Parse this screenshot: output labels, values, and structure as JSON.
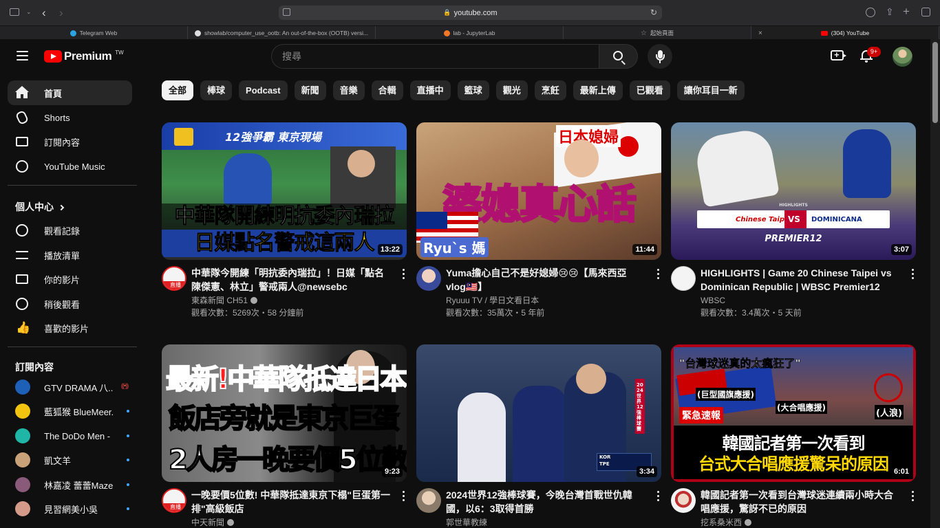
{
  "browser": {
    "url": "youtube.com",
    "tabs": [
      {
        "label": "Telegram Web",
        "color": "#2aa3e0"
      },
      {
        "label": "showlab/computer_use_ootb: An out-of-the-box (OOTB) versi...",
        "color": "#dddddd"
      },
      {
        "label": "lab - JupyterLab",
        "color": "#f37726"
      },
      {
        "label": "起始頁面",
        "color": "#999999"
      },
      {
        "label": "(304) YouTube",
        "color": "#ff0000"
      }
    ]
  },
  "masthead": {
    "logo_text": "Premium",
    "region": "TW",
    "search_placeholder": "搜尋",
    "notification_count": "9+"
  },
  "sidebar": {
    "main": [
      {
        "label": "首頁",
        "icon": "home-icon"
      },
      {
        "label": "Shorts",
        "icon": "shorts-icon"
      },
      {
        "label": "訂閱內容",
        "icon": "subscriptions-icon"
      },
      {
        "label": "YouTube Music",
        "icon": "youtube-music-icon"
      }
    ],
    "you_header": "個人中心",
    "you": [
      {
        "label": "觀看記錄",
        "icon": "history-icon"
      },
      {
        "label": "播放清單",
        "icon": "playlists-icon"
      },
      {
        "label": "你的影片",
        "icon": "your-videos-icon"
      },
      {
        "label": "稍後觀看",
        "icon": "watch-later-icon"
      },
      {
        "label": "喜歡的影片",
        "icon": "liked-videos-icon"
      }
    ],
    "subs_header": "訂閱內容",
    "subscriptions": [
      {
        "label": "GTV DRAMA 八...",
        "live": true,
        "color": "#1e5fb8"
      },
      {
        "label": "藍狐猴 BlueMeer...",
        "live": false,
        "color": "#f2c40f"
      },
      {
        "label": "The DoDo Men - ...",
        "live": false,
        "color": "#1fb6a8"
      },
      {
        "label": "凱文羊",
        "live": false,
        "color": "#c9a27a"
      },
      {
        "label": "林嘉凌 蕾蕾Maze",
        "live": false,
        "color": "#8a5a7a"
      },
      {
        "label": "見習網美小吳",
        "live": false,
        "color": "#d49a8a"
      }
    ]
  },
  "chips": [
    "全部",
    "棒球",
    "Podcast",
    "新聞",
    "音樂",
    "合輯",
    "直播中",
    "籃球",
    "觀光",
    "烹飪",
    "最新上傳",
    "已觀看",
    "讓你耳目一新"
  ],
  "videos": [
    {
      "title": "中華隊今開練「明抗委內瑞拉」！日媒「點名 陳傑憲、林立」警戒兩人@newsebc",
      "channel": "東森新聞 CH51",
      "verified": true,
      "stats": "觀看次數：5269次・58 分鐘前",
      "duration": "13:22",
      "thumb_lines": [
        "中華隊開練明抗委內瑞拉",
        "日媒點名警戒這兩人"
      ],
      "thumb_top": "12強爭霸 東京現場",
      "avatar_tag": "直播"
    },
    {
      "title": "Yuma擔心自己不是好媳婦😢😢【馬來西亞vlog🇲🇾】",
      "channel": "Ryuuu TV / 學日文看日本",
      "verified": false,
      "stats": "觀看次數：35萬次・5 年前",
      "duration": "11:44",
      "thumb_lines": [
        "婆媳真心話"
      ],
      "thumb_top": "日本媳婦",
      "thumb_tag": "Ryu`s 媽"
    },
    {
      "title": "HIGHLIGHTS | Game 20 Chinese Taipei vs Dominican Republic | WBSC Premier12 202...",
      "channel": "WBSC",
      "verified": false,
      "stats": "觀看次數：3.4萬次・5 天前",
      "duration": "3:07",
      "thumb_lines": [
        "HIGHLIGHTS",
        "Chinese Taipei",
        "VS",
        "DOMINICANA",
        "PREMIER12"
      ]
    },
    {
      "title": "一晚要價5位數! 中華隊抵達東京下榻\"巨蛋第一排\"高級飯店",
      "channel": "中天新聞",
      "verified": true,
      "stats": "",
      "duration": "9:23",
      "thumb_lines": [
        "最新!中華隊抵達日本",
        "飯店旁就是東京巨蛋",
        "2人房一晚要價5位數!"
      ],
      "avatar_tag": "直播"
    },
    {
      "title": "2024世界12強棒球賽，今晚台灣首戰世仇韓國，以6：3取得首勝",
      "channel": "郭世華教練",
      "verified": false,
      "stats": "",
      "duration": "3:34",
      "thumb_lines": [
        "KOR",
        "TPE",
        "2024世界12強棒球賽"
      ]
    },
    {
      "title": "韓國記者第一次看到台灣球迷連續兩小時大合唱應援，驚訝不已的原因",
      "channel": "挖系桑米西",
      "verified": true,
      "stats": "",
      "duration": "6:01",
      "thumb_lines": [
        "\"台灣球迷真的太瘋狂了\"",
        "(巨型國旗應援)",
        "(大合唱應援)",
        "(人浪)",
        "緊急速報",
        "韓國記者第一次看到",
        "台式大合唱應援驚呆的原因"
      ]
    }
  ]
}
